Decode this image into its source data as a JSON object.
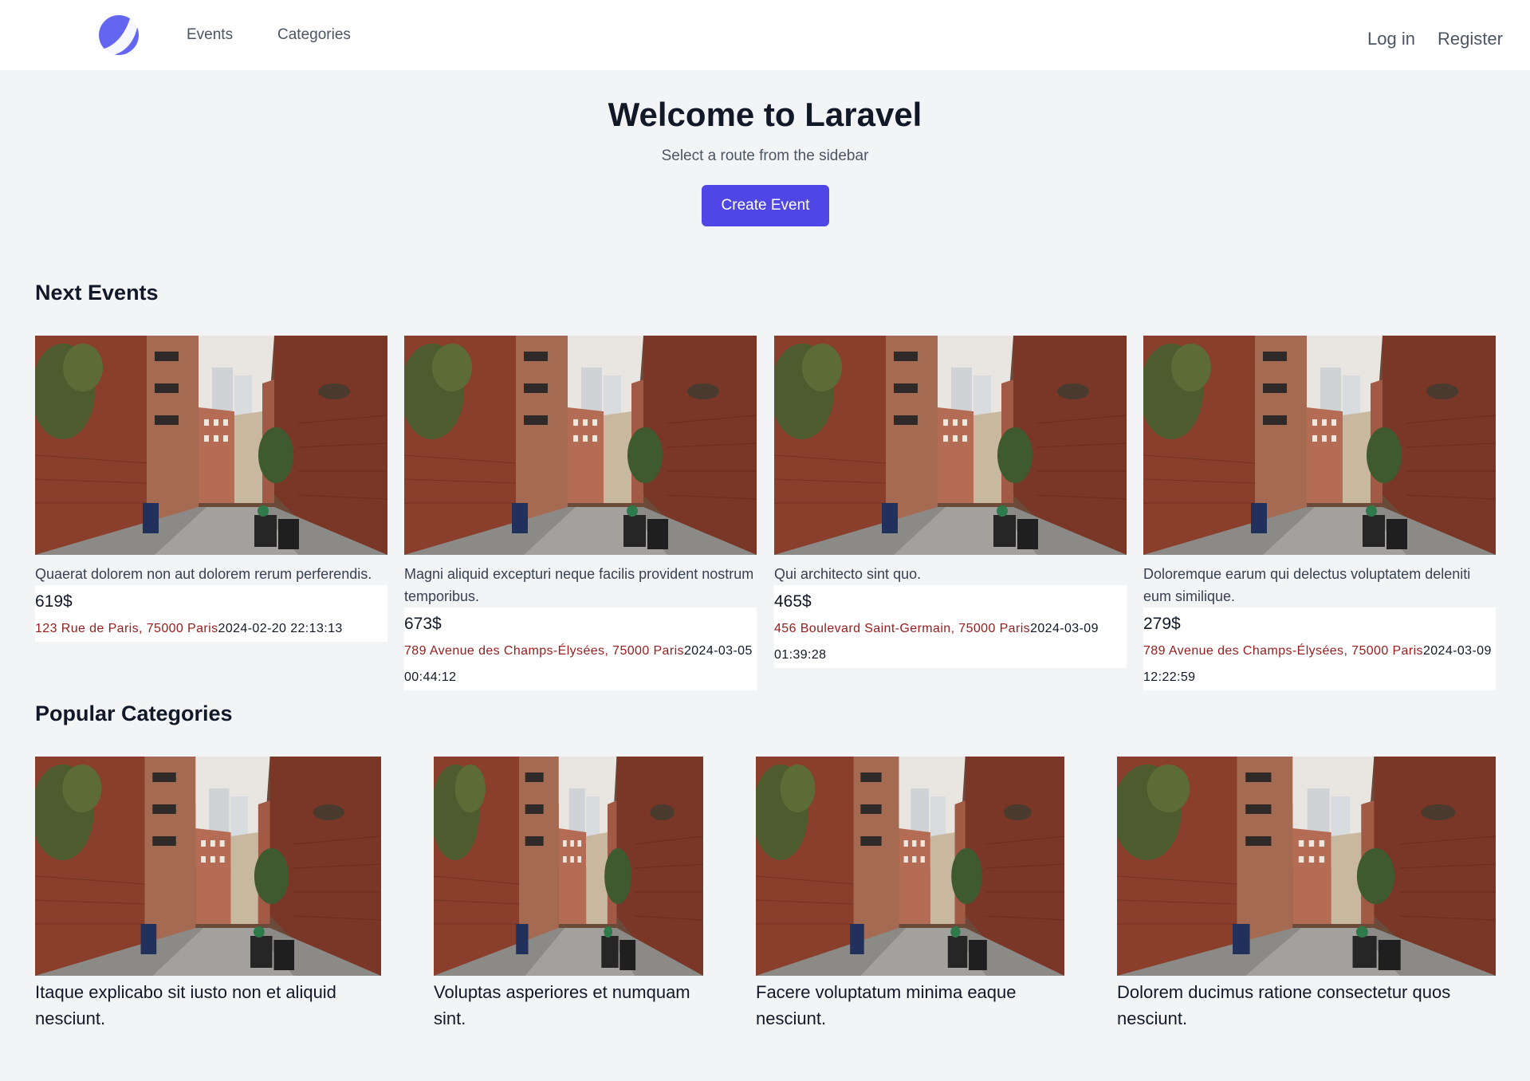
{
  "nav": {
    "links": [
      {
        "label": "Events"
      },
      {
        "label": "Categories"
      }
    ],
    "login_label": "Log in",
    "register_label": "Register"
  },
  "hero": {
    "title": "Welcome to Laravel",
    "subtitle": "Select a route from the sidebar",
    "cta_label": "Create Event"
  },
  "colors": {
    "accent": "#4f46e5",
    "address": "#991b1b",
    "background": "#f3f4f6"
  },
  "next_events": {
    "heading": "Next Events",
    "items": [
      {
        "title": "Quaerat dolorem non aut dolorem rerum perferendis.",
        "price": "619$",
        "address": "123 Rue de Paris, 75000 Paris",
        "datetime": "2024-02-20 22:13:13"
      },
      {
        "title": "Magni aliquid excepturi neque facilis provident nostrum temporibus.",
        "price": "673$",
        "address": "789 Avenue des Champs-Élysées, 75000 Paris",
        "datetime": "2024-03-05 00:44:12"
      },
      {
        "title": "Qui architecto sint quo.",
        "price": "465$",
        "address": "456 Boulevard Saint-Germain, 75000 Paris",
        "datetime": "2024-03-09 01:39:28"
      },
      {
        "title": "Doloremque earum qui delectus voluptatem deleniti eum similique.",
        "price": "279$",
        "address": "789 Avenue des Champs-Élysées, 75000 Paris",
        "datetime": "2024-03-09 12:22:59"
      }
    ]
  },
  "popular_categories": {
    "heading": "Popular Categories",
    "items": [
      {
        "title": "Itaque explicabo sit iusto non et aliquid nesciunt."
      },
      {
        "title": "Voluptas asperiores et numquam sint."
      },
      {
        "title": "Facere voluptatum minima eaque nesciunt."
      },
      {
        "title": "Dolorem ducimus ratione consectetur quos nesciunt."
      }
    ]
  }
}
